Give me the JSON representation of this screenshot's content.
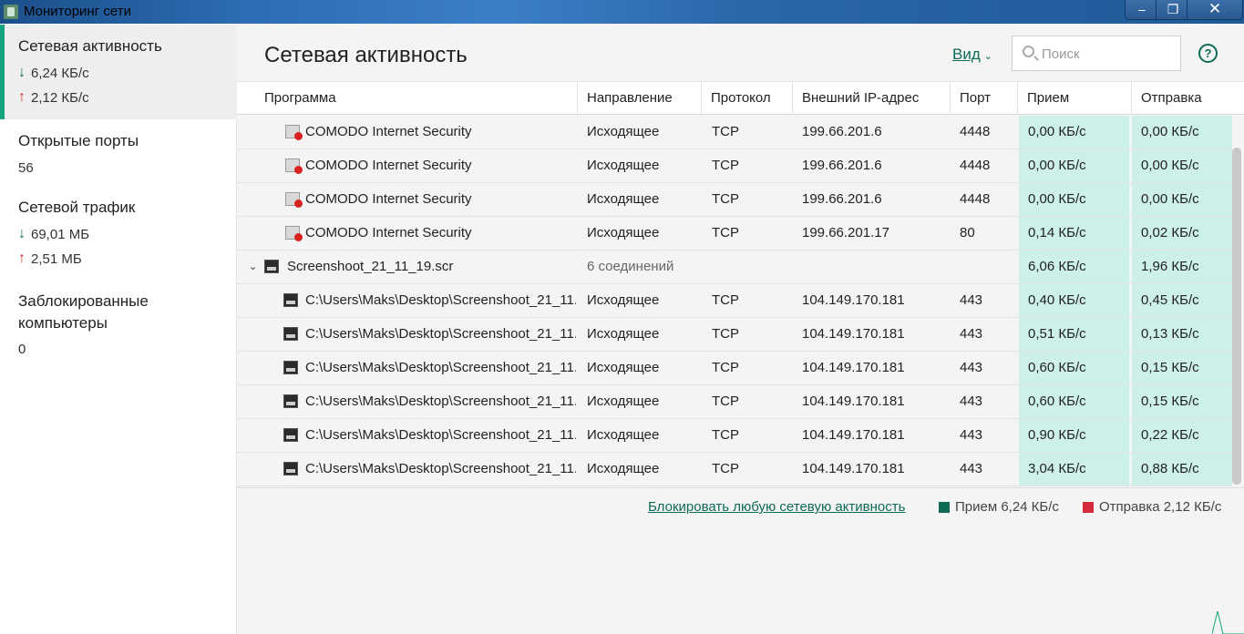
{
  "window": {
    "title": "Мониторинг сети",
    "min_glyph": "–",
    "max_glyph": "❐",
    "close_glyph": "✕"
  },
  "sidebar": {
    "network_activity": {
      "title": "Сетевая активность",
      "down": "6,24 КБ/с",
      "up": "2,12 КБ/с"
    },
    "open_ports": {
      "title": "Открытые порты",
      "value": "56"
    },
    "network_traffic": {
      "title": "Сетевой трафик",
      "down": "69,01 МБ",
      "up": "2,51 МБ"
    },
    "blocked": {
      "title_line1": "Заблокированные",
      "title_line2": "компьютеры",
      "value": "0"
    },
    "arrow_down": "↓",
    "arrow_up": "↑"
  },
  "main": {
    "title": "Сетевая активность",
    "view_label": "Вид",
    "view_chevron": "⌄",
    "search_placeholder": "Поиск",
    "help_glyph": "?",
    "columns": [
      "Программа",
      "Направление",
      "Протокол",
      "Внешний IP-адрес",
      "Порт",
      "Прием",
      "Отправка"
    ],
    "rows": [
      {
        "program": "COMODO Internet Security",
        "direction": "Исходящее",
        "protocol": "TCP",
        "ip": "199.66.201.6",
        "port": "4448",
        "rx": "0,00 КБ/с",
        "tx": "0,00 КБ/с"
      },
      {
        "program": "COMODO Internet Security",
        "direction": "Исходящее",
        "protocol": "TCP",
        "ip": "199.66.201.6",
        "port": "4448",
        "rx": "0,00 КБ/с",
        "tx": "0,00 КБ/с"
      },
      {
        "program": "COMODO Internet Security",
        "direction": "Исходящее",
        "protocol": "TCP",
        "ip": "199.66.201.6",
        "port": "4448",
        "rx": "0,00 КБ/с",
        "tx": "0,00 КБ/с"
      },
      {
        "program": "COMODO Internet Security",
        "direction": "Исходящее",
        "protocol": "TCP",
        "ip": "199.66.201.17",
        "port": "80",
        "rx": "0,14 КБ/с",
        "tx": "0,02 КБ/с"
      }
    ],
    "group": {
      "expander": "⌄",
      "program": "Screenshoot_21_11_19.scr",
      "connections": "6 соединений",
      "rx": "6,06 КБ/с",
      "tx": "1,96 КБ/с"
    },
    "group_rows": [
      {
        "program": "C:\\Users\\Maks\\Desktop\\Screenshoot_21_11...",
        "direction": "Исходящее",
        "protocol": "TCP",
        "ip": "104.149.170.181",
        "port": "443",
        "rx": "0,40 КБ/с",
        "tx": "0,45 КБ/с"
      },
      {
        "program": "C:\\Users\\Maks\\Desktop\\Screenshoot_21_11...",
        "direction": "Исходящее",
        "protocol": "TCP",
        "ip": "104.149.170.181",
        "port": "443",
        "rx": "0,51 КБ/с",
        "tx": "0,13 КБ/с"
      },
      {
        "program": "C:\\Users\\Maks\\Desktop\\Screenshoot_21_11...",
        "direction": "Исходящее",
        "protocol": "TCP",
        "ip": "104.149.170.181",
        "port": "443",
        "rx": "0,60 КБ/с",
        "tx": "0,15 КБ/с"
      },
      {
        "program": "C:\\Users\\Maks\\Desktop\\Screenshoot_21_11...",
        "direction": "Исходящее",
        "protocol": "TCP",
        "ip": "104.149.170.181",
        "port": "443",
        "rx": "0,60 КБ/с",
        "tx": "0,15 КБ/с"
      },
      {
        "program": "C:\\Users\\Maks\\Desktop\\Screenshoot_21_11...",
        "direction": "Исходящее",
        "protocol": "TCP",
        "ip": "104.149.170.181",
        "port": "443",
        "rx": "0,90 КБ/с",
        "tx": "0,22 КБ/с"
      },
      {
        "program": "C:\\Users\\Maks\\Desktop\\Screenshoot_21_11...",
        "direction": "Исходящее",
        "protocol": "TCP",
        "ip": "104.149.170.181",
        "port": "443",
        "rx": "3,04 КБ/с",
        "tx": "0,88 КБ/с"
      }
    ],
    "footer": {
      "block_link": "Блокировать любую сетевую активность",
      "legend_rx": "Прием 6,24 КБ/с",
      "legend_tx": "Отправка 2,12 КБ/с"
    }
  },
  "colors": {
    "accent": "#0e6b55",
    "rx_swatch": "#0e6b55",
    "tx_swatch": "#d42c3c",
    "traffic_cell": "#cdf1e9",
    "active_indicator": "#14a17e"
  }
}
